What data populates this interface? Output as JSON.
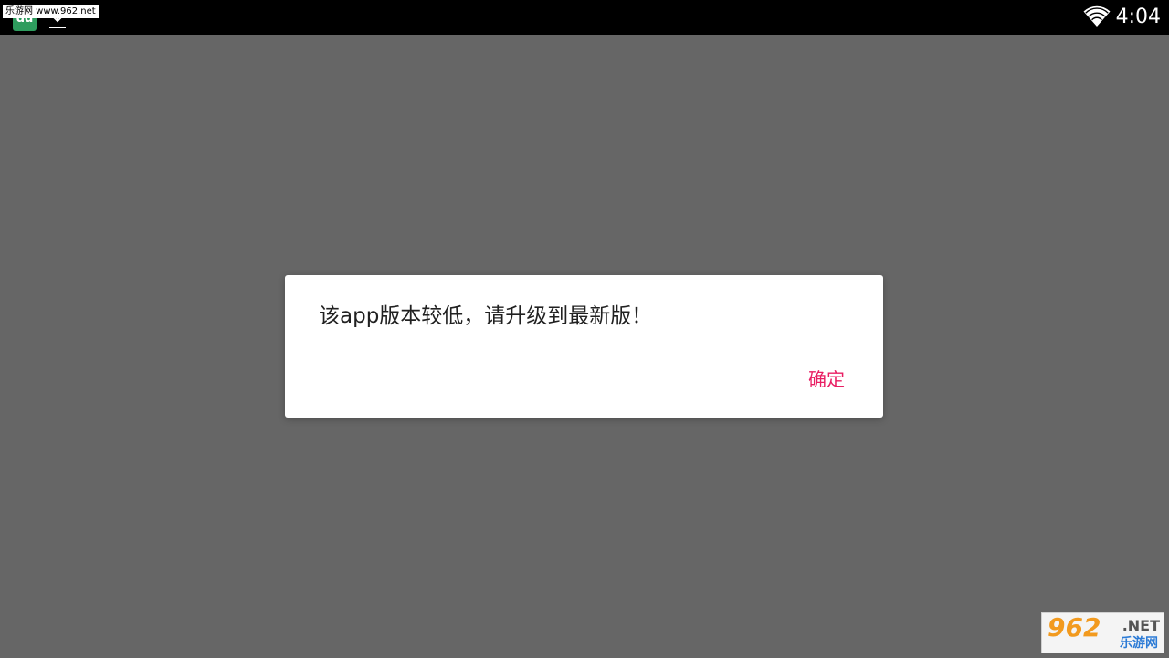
{
  "status_bar": {
    "time": "4:04",
    "watermark_text": "乐游网 www.962.net",
    "app_icon_label": "dd",
    "icons": [
      "app-icon",
      "download-icon",
      "wifi-icon"
    ]
  },
  "dialog": {
    "message": "该app版本较低，请升级到最新版！",
    "ok_label": "确定"
  },
  "watermark_badge": {
    "number": "962",
    "suffix": ".NET",
    "subtitle": "乐游网"
  },
  "colors": {
    "background_dim": "#666666",
    "status_bar": "#000000",
    "dialog": "#ffffff",
    "accent": "#e91e63"
  }
}
